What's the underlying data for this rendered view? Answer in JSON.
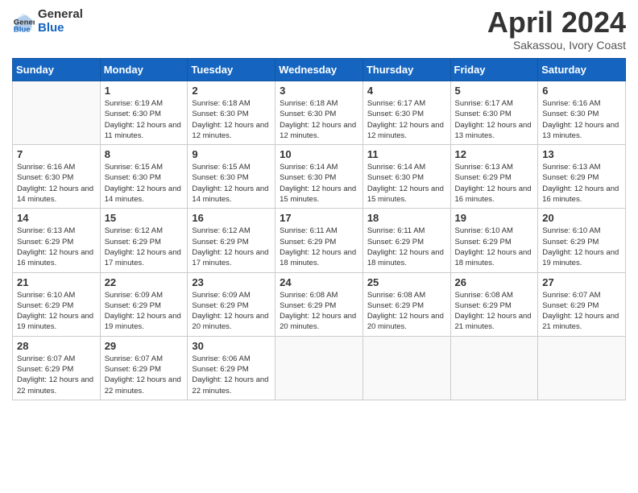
{
  "header": {
    "logo_line1": "General",
    "logo_line2": "Blue",
    "month": "April 2024",
    "location": "Sakassou, Ivory Coast"
  },
  "weekdays": [
    "Sunday",
    "Monday",
    "Tuesday",
    "Wednesday",
    "Thursday",
    "Friday",
    "Saturday"
  ],
  "weeks": [
    [
      {
        "day": "",
        "sunrise": "",
        "sunset": "",
        "daylight": ""
      },
      {
        "day": "1",
        "sunrise": "Sunrise: 6:19 AM",
        "sunset": "Sunset: 6:30 PM",
        "daylight": "Daylight: 12 hours and 11 minutes."
      },
      {
        "day": "2",
        "sunrise": "Sunrise: 6:18 AM",
        "sunset": "Sunset: 6:30 PM",
        "daylight": "Daylight: 12 hours and 12 minutes."
      },
      {
        "day": "3",
        "sunrise": "Sunrise: 6:18 AM",
        "sunset": "Sunset: 6:30 PM",
        "daylight": "Daylight: 12 hours and 12 minutes."
      },
      {
        "day": "4",
        "sunrise": "Sunrise: 6:17 AM",
        "sunset": "Sunset: 6:30 PM",
        "daylight": "Daylight: 12 hours and 12 minutes."
      },
      {
        "day": "5",
        "sunrise": "Sunrise: 6:17 AM",
        "sunset": "Sunset: 6:30 PM",
        "daylight": "Daylight: 12 hours and 13 minutes."
      },
      {
        "day": "6",
        "sunrise": "Sunrise: 6:16 AM",
        "sunset": "Sunset: 6:30 PM",
        "daylight": "Daylight: 12 hours and 13 minutes."
      }
    ],
    [
      {
        "day": "7",
        "sunrise": "Sunrise: 6:16 AM",
        "sunset": "Sunset: 6:30 PM",
        "daylight": "Daylight: 12 hours and 14 minutes."
      },
      {
        "day": "8",
        "sunrise": "Sunrise: 6:15 AM",
        "sunset": "Sunset: 6:30 PM",
        "daylight": "Daylight: 12 hours and 14 minutes."
      },
      {
        "day": "9",
        "sunrise": "Sunrise: 6:15 AM",
        "sunset": "Sunset: 6:30 PM",
        "daylight": "Daylight: 12 hours and 14 minutes."
      },
      {
        "day": "10",
        "sunrise": "Sunrise: 6:14 AM",
        "sunset": "Sunset: 6:30 PM",
        "daylight": "Daylight: 12 hours and 15 minutes."
      },
      {
        "day": "11",
        "sunrise": "Sunrise: 6:14 AM",
        "sunset": "Sunset: 6:30 PM",
        "daylight": "Daylight: 12 hours and 15 minutes."
      },
      {
        "day": "12",
        "sunrise": "Sunrise: 6:13 AM",
        "sunset": "Sunset: 6:29 PM",
        "daylight": "Daylight: 12 hours and 16 minutes."
      },
      {
        "day": "13",
        "sunrise": "Sunrise: 6:13 AM",
        "sunset": "Sunset: 6:29 PM",
        "daylight": "Daylight: 12 hours and 16 minutes."
      }
    ],
    [
      {
        "day": "14",
        "sunrise": "Sunrise: 6:13 AM",
        "sunset": "Sunset: 6:29 PM",
        "daylight": "Daylight: 12 hours and 16 minutes."
      },
      {
        "day": "15",
        "sunrise": "Sunrise: 6:12 AM",
        "sunset": "Sunset: 6:29 PM",
        "daylight": "Daylight: 12 hours and 17 minutes."
      },
      {
        "day": "16",
        "sunrise": "Sunrise: 6:12 AM",
        "sunset": "Sunset: 6:29 PM",
        "daylight": "Daylight: 12 hours and 17 minutes."
      },
      {
        "day": "17",
        "sunrise": "Sunrise: 6:11 AM",
        "sunset": "Sunset: 6:29 PM",
        "daylight": "Daylight: 12 hours and 18 minutes."
      },
      {
        "day": "18",
        "sunrise": "Sunrise: 6:11 AM",
        "sunset": "Sunset: 6:29 PM",
        "daylight": "Daylight: 12 hours and 18 minutes."
      },
      {
        "day": "19",
        "sunrise": "Sunrise: 6:10 AM",
        "sunset": "Sunset: 6:29 PM",
        "daylight": "Daylight: 12 hours and 18 minutes."
      },
      {
        "day": "20",
        "sunrise": "Sunrise: 6:10 AM",
        "sunset": "Sunset: 6:29 PM",
        "daylight": "Daylight: 12 hours and 19 minutes."
      }
    ],
    [
      {
        "day": "21",
        "sunrise": "Sunrise: 6:10 AM",
        "sunset": "Sunset: 6:29 PM",
        "daylight": "Daylight: 12 hours and 19 minutes."
      },
      {
        "day": "22",
        "sunrise": "Sunrise: 6:09 AM",
        "sunset": "Sunset: 6:29 PM",
        "daylight": "Daylight: 12 hours and 19 minutes."
      },
      {
        "day": "23",
        "sunrise": "Sunrise: 6:09 AM",
        "sunset": "Sunset: 6:29 PM",
        "daylight": "Daylight: 12 hours and 20 minutes."
      },
      {
        "day": "24",
        "sunrise": "Sunrise: 6:08 AM",
        "sunset": "Sunset: 6:29 PM",
        "daylight": "Daylight: 12 hours and 20 minutes."
      },
      {
        "day": "25",
        "sunrise": "Sunrise: 6:08 AM",
        "sunset": "Sunset: 6:29 PM",
        "daylight": "Daylight: 12 hours and 20 minutes."
      },
      {
        "day": "26",
        "sunrise": "Sunrise: 6:08 AM",
        "sunset": "Sunset: 6:29 PM",
        "daylight": "Daylight: 12 hours and 21 minutes."
      },
      {
        "day": "27",
        "sunrise": "Sunrise: 6:07 AM",
        "sunset": "Sunset: 6:29 PM",
        "daylight": "Daylight: 12 hours and 21 minutes."
      }
    ],
    [
      {
        "day": "28",
        "sunrise": "Sunrise: 6:07 AM",
        "sunset": "Sunset: 6:29 PM",
        "daylight": "Daylight: 12 hours and 22 minutes."
      },
      {
        "day": "29",
        "sunrise": "Sunrise: 6:07 AM",
        "sunset": "Sunset: 6:29 PM",
        "daylight": "Daylight: 12 hours and 22 minutes."
      },
      {
        "day": "30",
        "sunrise": "Sunrise: 6:06 AM",
        "sunset": "Sunset: 6:29 PM",
        "daylight": "Daylight: 12 hours and 22 minutes."
      },
      {
        "day": "",
        "sunrise": "",
        "sunset": "",
        "daylight": ""
      },
      {
        "day": "",
        "sunrise": "",
        "sunset": "",
        "daylight": ""
      },
      {
        "day": "",
        "sunrise": "",
        "sunset": "",
        "daylight": ""
      },
      {
        "day": "",
        "sunrise": "",
        "sunset": "",
        "daylight": ""
      }
    ]
  ]
}
